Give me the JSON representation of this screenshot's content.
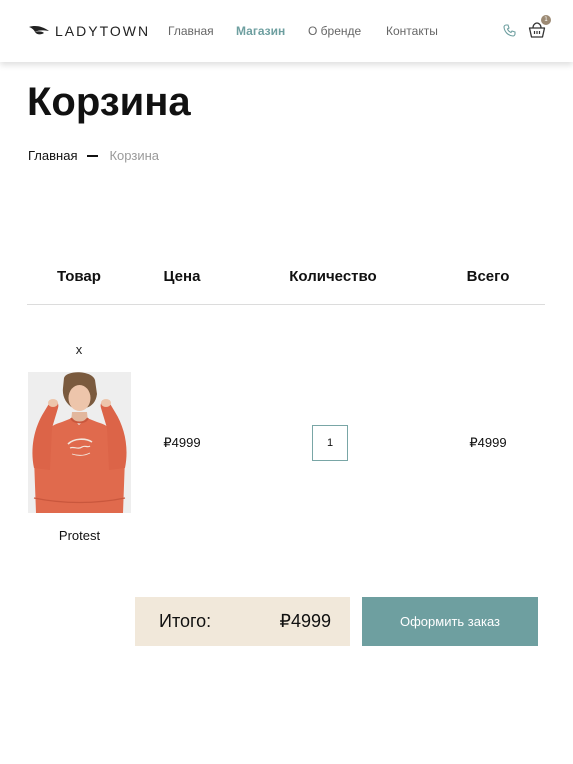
{
  "header": {
    "brand": "LADYTOWN",
    "nav": [
      {
        "label": "Главная",
        "active": false
      },
      {
        "label": "Магазин",
        "active": true
      },
      {
        "label": "О бренде",
        "active": false
      },
      {
        "label": "Контакты",
        "active": false
      }
    ],
    "icons": [
      "brand-logo-icon",
      "phone-icon",
      "cart-icon"
    ],
    "cart_count": "1"
  },
  "page": {
    "title": "Корзина",
    "breadcrumb": {
      "home": "Главная",
      "current": "Корзина"
    }
  },
  "cart": {
    "columns": {
      "product": "Товар",
      "price": "Цена",
      "quantity": "Количество",
      "total": "Всего"
    },
    "items": [
      {
        "remove": "x",
        "name": "Protest",
        "price": "₽4999",
        "quantity": "1",
        "total": "₽4999"
      }
    ],
    "summary": {
      "label": "Итого:",
      "value": "₽4999"
    },
    "checkout": "Оформить заказ"
  },
  "colors": {
    "accent": "#6e9fa0",
    "summary_bg": "#f1e8da",
    "badge": "#9c8a74",
    "product_sweater": "#e06a4d"
  }
}
